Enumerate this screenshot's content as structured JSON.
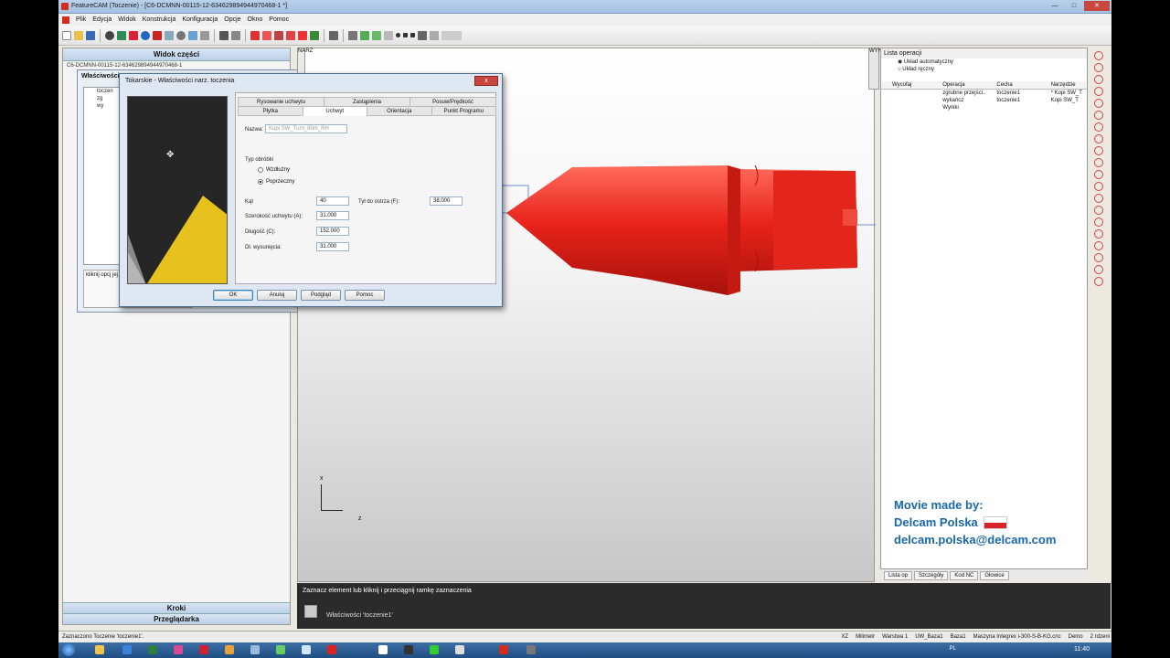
{
  "window": {
    "title": "FeatureCAM (Toczenie) - [C6-DCMNN-00115-12-6346298949449704​68-1 *]"
  },
  "menu": [
    "Plik",
    "Edycja",
    "Widok",
    "Konstrukcja",
    "Konfiguracja",
    "Opcje",
    "Okno",
    "Pomoc"
  ],
  "left_panel": {
    "title": "Widok części",
    "path": "C6-DCMNN-00115-12-634629894944970468-1",
    "footer1": "Kroki",
    "footer2": "Przeglądarka",
    "props_title": "Właściwości",
    "tree": [
      "toczen",
      "zg",
      "wy"
    ],
    "desc": "kliknij opcj jej atrybuty i posuw/pręd"
  },
  "dialog": {
    "title": "Tokarskie - Właściwości narz. toczenia",
    "close": "x",
    "tabs_top": [
      "Rysowanie uchwytu",
      "Zastąpienia",
      "Posuw/Prędkość"
    ],
    "tabs_bottom": [
      "Płytka",
      "Uchwyt",
      "Orientacja",
      "Punkt Programu"
    ],
    "name_label": "Nazwa:",
    "name_value": "Kopi SW_Turn_80m_RH",
    "type_label": "Typ obróbki",
    "radio1": "Wzdłużny",
    "radio2": "Poprzeczny",
    "angle_label": "Kąt",
    "angle_value": "40",
    "back_label": "Tył do ostrza (F):",
    "back_value": "38.000",
    "width_label": "Szerokość uchwytu (A):",
    "width_value": "31.000",
    "length_label": "Długość (C):",
    "length_value": "152.000",
    "reach_label": "Dł. wysunięcia:",
    "reach_value": "31.000",
    "btn_ok": "OK",
    "btn_cancel": "Anuluj",
    "btn_preview": "Podgląd",
    "btn_help": "Pomoc"
  },
  "viewport": {
    "side_tab": "NARZ",
    "axis_x": "x",
    "axis_z": "z",
    "part_color": "#e8231a"
  },
  "messages": {
    "hint": "Zaznacz element lub kliknij i przeciągnij ramkę zaznaczenia",
    "props": "Właściwości 'toczenie1'"
  },
  "ops": {
    "title": "Lista operacji",
    "radio_auto": "Układ automatyczny",
    "radio_manual": "Układ ręczny",
    "side_tab": "WYNIKI",
    "headers": [
      "Wycofaj",
      "Operacja",
      "Cecha",
      "Narzędzie"
    ],
    "rows": [
      [
        "",
        "zgrubne przejści..",
        "toczenie1",
        "* Kopi SW_T"
      ],
      [
        "",
        "wykańcz",
        "toczenie1",
        "Kopi SW_T"
      ],
      [
        "",
        "Wyniki",
        "",
        ""
      ]
    ],
    "tabs": [
      "Lista op",
      "Szczegóły",
      "Kod NC",
      "Głowice"
    ]
  },
  "credits": {
    "line1": "Movie made by:",
    "line2": "Delcam Polska",
    "line3": "delcam.polska@delcam.com"
  },
  "status": {
    "left": "Zaznaczono Toczenie 'toczenie1'.",
    "items": [
      "XZ",
      "Milimetr",
      "Warstwa 1",
      "UW_Baza1",
      "Baza1",
      "Maszyna Integrex i-300-S-B-KG.cnc",
      "Demo",
      "2 rdzeni"
    ]
  },
  "taskbar": {
    "lang": "PL",
    "clock": "11:40"
  },
  "colors": {
    "accent": "#1a67a8",
    "part": "#e8231a",
    "insert": "#e7c21f"
  }
}
